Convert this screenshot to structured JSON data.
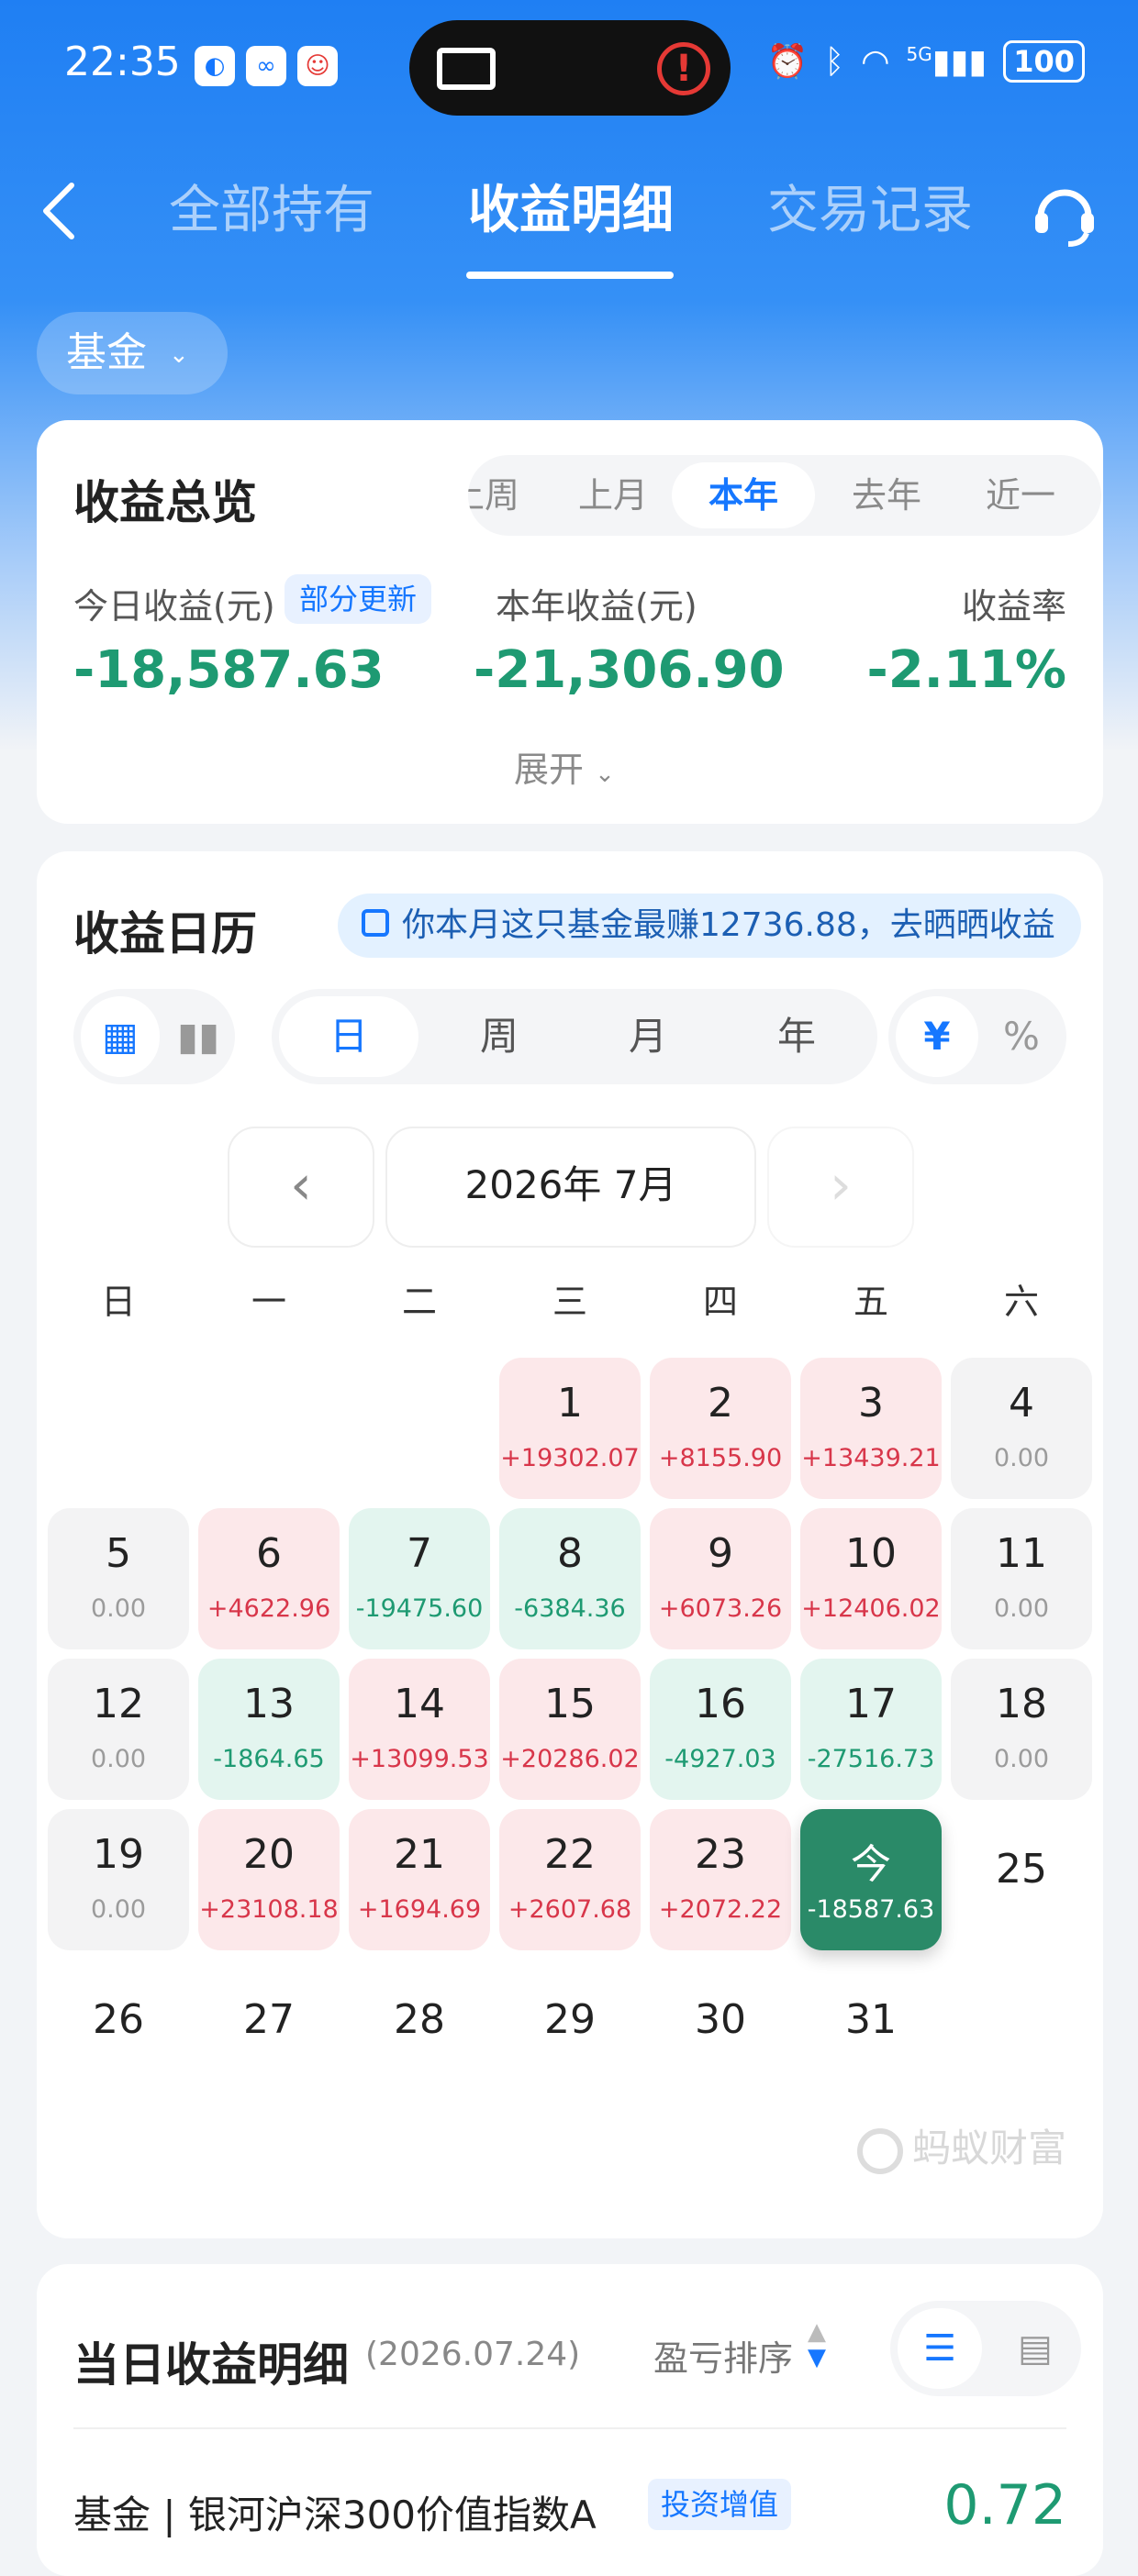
{
  "status_bar": {
    "time": "22:35",
    "battery": "100",
    "network": "5G"
  },
  "header": {
    "tabs": [
      {
        "label": "全部持有",
        "active": false
      },
      {
        "label": "收益明细",
        "active": true
      },
      {
        "label": "交易记录",
        "active": false
      }
    ]
  },
  "filter": {
    "label": "基金"
  },
  "overview": {
    "title": "收益总览",
    "periods": [
      "上周",
      "上月",
      "本年",
      "去年",
      "近一"
    ],
    "selected_period": "本年",
    "today_label": "今日收益(元)",
    "partial_badge": "部分更新",
    "today_value": "-18,587.63",
    "year_label": "本年收益(元)",
    "year_value": "-21,306.90",
    "rate_label": "收益率",
    "rate_value": "-2.11%",
    "expand_label": "展开"
  },
  "calendar": {
    "title": "收益日历",
    "share_text": "你本月这只基金最赚12736.88，去晒晒收益",
    "view_modes": [
      "日",
      "周",
      "月",
      "年"
    ],
    "selected_view": "日",
    "unit_modes": [
      "¥",
      "%"
    ],
    "selected_unit": "¥",
    "month_label": "2026年 7月",
    "weekdays": [
      "日",
      "一",
      "二",
      "三",
      "四",
      "五",
      "六"
    ],
    "today_label": "今",
    "days": [
      {
        "day": "1",
        "value": "+19302.07",
        "kind": "pos"
      },
      {
        "day": "2",
        "value": "+8155.90",
        "kind": "pos"
      },
      {
        "day": "3",
        "value": "+13439.21",
        "kind": "pos"
      },
      {
        "day": "4",
        "value": "0.00",
        "kind": "zero"
      },
      {
        "day": "5",
        "value": "0.00",
        "kind": "zero"
      },
      {
        "day": "6",
        "value": "+4622.96",
        "kind": "pos"
      },
      {
        "day": "7",
        "value": "-19475.60",
        "kind": "neg"
      },
      {
        "day": "8",
        "value": "-6384.36",
        "kind": "neg"
      },
      {
        "day": "9",
        "value": "+6073.26",
        "kind": "pos"
      },
      {
        "day": "10",
        "value": "+12406.02",
        "kind": "pos"
      },
      {
        "day": "11",
        "value": "0.00",
        "kind": "zero"
      },
      {
        "day": "12",
        "value": "0.00",
        "kind": "zero"
      },
      {
        "day": "13",
        "value": "-1864.65",
        "kind": "neg"
      },
      {
        "day": "14",
        "value": "+13099.53",
        "kind": "pos"
      },
      {
        "day": "15",
        "value": "+20286.02",
        "kind": "pos"
      },
      {
        "day": "16",
        "value": "-4927.03",
        "kind": "neg"
      },
      {
        "day": "17",
        "value": "-27516.73",
        "kind": "neg"
      },
      {
        "day": "18",
        "value": "0.00",
        "kind": "zero"
      },
      {
        "day": "19",
        "value": "0.00",
        "kind": "zero"
      },
      {
        "day": "20",
        "value": "+23108.18",
        "kind": "pos"
      },
      {
        "day": "21",
        "value": "+1694.69",
        "kind": "pos"
      },
      {
        "day": "22",
        "value": "+2607.68",
        "kind": "pos"
      },
      {
        "day": "23",
        "value": "+2072.22",
        "kind": "pos"
      },
      {
        "day": "今",
        "value": "-18587.63",
        "kind": "today"
      },
      {
        "day": "25",
        "value": "",
        "kind": "plain"
      },
      {
        "day": "26",
        "value": "",
        "kind": "plain"
      },
      {
        "day": "27",
        "value": "",
        "kind": "plain"
      },
      {
        "day": "28",
        "value": "",
        "kind": "plain"
      },
      {
        "day": "29",
        "value": "",
        "kind": "plain"
      },
      {
        "day": "30",
        "value": "",
        "kind": "plain"
      },
      {
        "day": "31",
        "value": "",
        "kind": "plain"
      }
    ],
    "first_weekday_index": 3,
    "watermark": "蚂蚁财富"
  },
  "daily_detail": {
    "title": "当日收益明细",
    "date": "(2026.07.24)",
    "sort_label": "盈亏排序",
    "fund_name": "基金 | 银河沪深300价值指数A",
    "fund_tag": "投资增值",
    "fund_value": "0.72"
  },
  "colors": {
    "accent": "#1677ff",
    "loss_green": "#1e9a72",
    "gain_red": "#d8364a",
    "today_bg": "#2a8a68"
  }
}
